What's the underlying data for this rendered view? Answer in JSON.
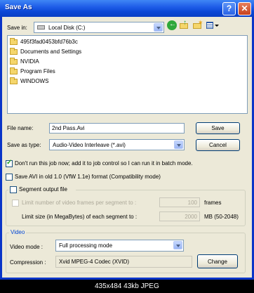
{
  "window": {
    "title": "Save As"
  },
  "save_in": {
    "label": "Save in:",
    "value": "Local Disk (C:)"
  },
  "folders": [
    "495f3fad0453bfd76b3c",
    "Documents and Settings",
    "NVIDIA",
    "Program Files",
    "WINDOWS"
  ],
  "file_name": {
    "label": "File name:",
    "value": "2nd Pass.Avi"
  },
  "save_as_type": {
    "label": "Save as type:",
    "value": "Audio-Video Interleave (*.avi)"
  },
  "buttons": {
    "save": "Save",
    "cancel": "Cancel",
    "change": "Change"
  },
  "options": {
    "dont_run": {
      "label": "Don't run this job now; add it to job control so I can run it in batch mode.",
      "checked": true
    },
    "old_avi": {
      "label": "Save AVI in old 1.0 (VfW 1.1e) format (Compatibility mode)",
      "checked": false
    }
  },
  "segment": {
    "label": "Segment output file",
    "limit_frames_label": "Limit number of video frames per segment to :",
    "frames_value": "100",
    "frames_unit": "frames",
    "limit_size_label": "Limit size (in MegaBytes) of each segment to :",
    "size_value": "2000",
    "size_unit": "MB (50-2048)"
  },
  "video": {
    "legend": "Video",
    "mode_label": "Video mode :",
    "mode_value": "Full processing mode",
    "compression_label": "Compression :",
    "compression_value": "Xvid MPEG-4 Codec (XVID)"
  },
  "status_bar": "435x484 43kb JPEG"
}
